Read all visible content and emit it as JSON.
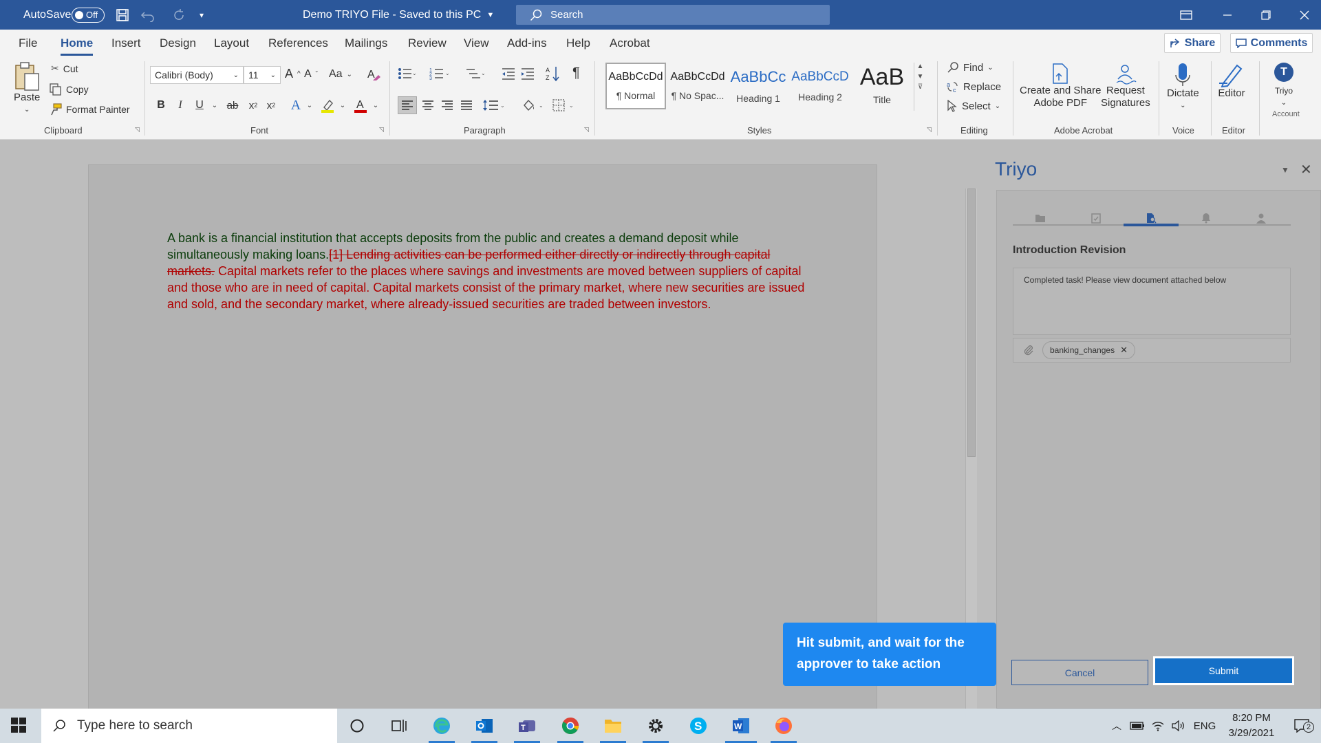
{
  "titlebar": {
    "autosave_label": "AutoSave",
    "autosave_state": "Off",
    "doc_title": "Demo TRIYO File  -  Saved to this PC",
    "search_placeholder": "Search"
  },
  "menu": {
    "tabs": [
      "File",
      "Home",
      "Insert",
      "Design",
      "Layout",
      "References",
      "Mailings",
      "Review",
      "View",
      "Add-ins",
      "Help",
      "Acrobat"
    ],
    "active": "Home",
    "share_label": "Share",
    "comments_label": "Comments"
  },
  "ribbon": {
    "clipboard": {
      "paste": "Paste",
      "cut": "Cut",
      "copy": "Copy",
      "format_painter": "Format Painter",
      "label": "Clipboard"
    },
    "font": {
      "name": "Calibri (Body)",
      "size": "11",
      "label": "Font"
    },
    "paragraph": {
      "label": "Paragraph"
    },
    "styles": {
      "label": "Styles",
      "items": [
        {
          "preview": "AaBbCcDd",
          "name": "¶ Normal"
        },
        {
          "preview": "AaBbCcDd",
          "name": "¶ No Spac..."
        },
        {
          "preview": "AaBbCc",
          "name": "Heading 1"
        },
        {
          "preview": "AaBbCcD",
          "name": "Heading 2"
        },
        {
          "preview": "AaB",
          "name": "Title"
        }
      ]
    },
    "editing": {
      "find": "Find",
      "replace": "Replace",
      "select": "Select",
      "label": "Editing"
    },
    "acrobat": {
      "create_line1": "Create and Share",
      "create_line2": "Adobe PDF",
      "request_line1": "Request",
      "request_line2": "Signatures",
      "label": "Adobe Acrobat"
    },
    "voice": {
      "dictate": "Dictate",
      "label": "Voice"
    },
    "editor": {
      "editor": "Editor",
      "label": "Editor"
    },
    "account": {
      "avatar_letter": "T",
      "name": "Triyo",
      "label": "Account"
    }
  },
  "document": {
    "unchanged_text": "A bank is a financial institution that accepts deposits from the public and creates a demand deposit while simultaneously making loans.",
    "deleted_text": "[1] Lending activities can be performed either directly or indirectly through capital markets.",
    "inserted_text": " Capital markets refer to the places where savings and investments are moved between suppliers of capital and those who are in need of capital. Capital markets consist of the primary market, where new securities are issued and sold, and the secondary market, where already-issued securities are traded between investors."
  },
  "pane": {
    "title": "Triyo",
    "section_title": "Introduction Revision",
    "message": "Completed task! Please view document attached below",
    "attachment": "banking_changes",
    "cancel_label": "Cancel",
    "submit_label": "Submit"
  },
  "tooltip": {
    "text": "Hit submit, and wait for the approver to take action"
  },
  "taskbar": {
    "search_placeholder": "Type here to search",
    "language": "ENG",
    "time": "8:20 PM",
    "date": "3/29/2021",
    "notification_count": "2"
  },
  "colors": {
    "word_blue": "#2b579a",
    "tracked_change_red": "#b00000",
    "tooltip_blue": "#1e88f0",
    "submit_blue": "#1570c8"
  }
}
